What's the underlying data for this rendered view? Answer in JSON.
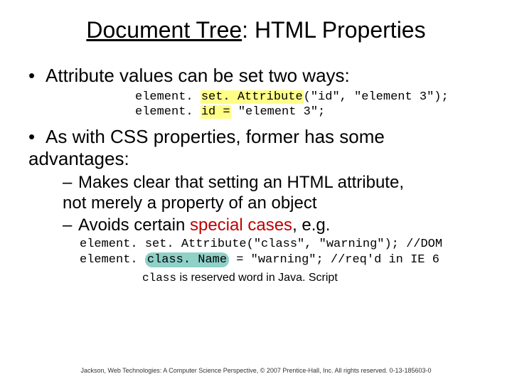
{
  "title": {
    "underlined": "Document Tree",
    "rest": ": HTML Properties"
  },
  "bullets": {
    "b1": "Attribute values can be set two ways:",
    "b2_a": "As with CSS properties, former has some",
    "b2_b": "advantages:",
    "sub1_a": "Makes clear that setting an HTML attribute,",
    "sub1_b": "not merely a property of an object",
    "sub2_a": "Avoids certain ",
    "sub2_red": "special cases",
    "sub2_b": ", e.g."
  },
  "code1": {
    "l1a": "element. ",
    "l1h": "set. Attribute",
    "l1b": "(\"id\", \"element 3\");",
    "l2a": "element. ",
    "l2h": "id =",
    "l2b": " \"element 3\";"
  },
  "code2": {
    "l1": "element. set. Attribute(\"class\", \"warning\"); //DOM",
    "l2a": "element. ",
    "l2h": "class. Name",
    "l2b": " = \"warning\"; //req'd in IE 6"
  },
  "note": {
    "code": "class",
    "rest": " is reserved word in Java. Script"
  },
  "footer": "Jackson, Web Technologies: A Computer Science Perspective, © 2007 Prentice-Hall, Inc. All rights reserved. 0-13-185603-0"
}
